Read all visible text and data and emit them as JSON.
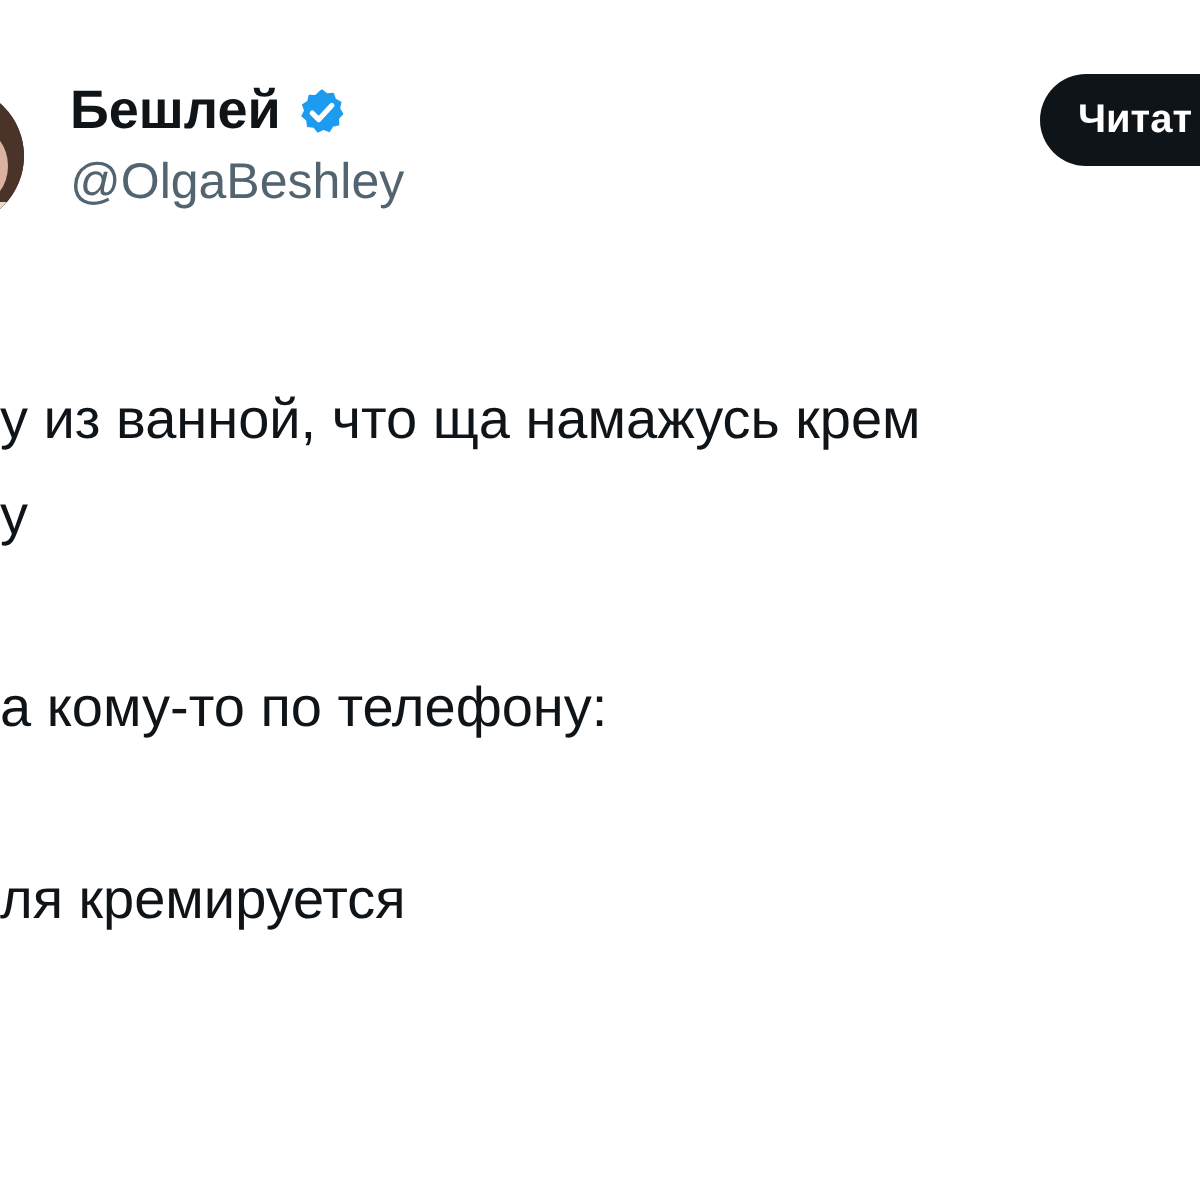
{
  "author": {
    "name": "Бешлей",
    "verified": true,
    "handle": "@OlgaBeshley"
  },
  "follow_button": {
    "label": "Читат"
  },
  "tweet": {
    "paragraphs": [
      [
        "у из ванной, что ща намажусь крем",
        "у"
      ],
      [
        "а кому-то по телефону:"
      ],
      [
        "ля кремируется"
      ]
    ]
  }
}
